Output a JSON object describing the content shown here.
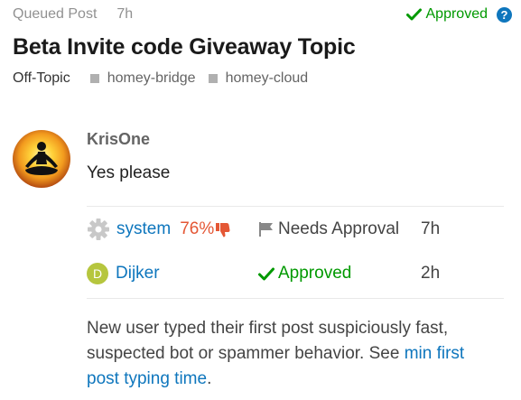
{
  "header": {
    "queued_label": "Queued Post",
    "queued_time": "7h",
    "status": "Approved"
  },
  "topic": {
    "title": "Beta Invite code Giveaway Topic",
    "category": "Off-Topic",
    "tags": [
      "homey-bridge",
      "homey-cloud"
    ]
  },
  "post": {
    "author": "KrisOne",
    "body": "Yes please"
  },
  "reviews": [
    {
      "user": "system",
      "score": "76%",
      "action": "Needs Approval",
      "time": "7h"
    },
    {
      "user": "Dijker",
      "avatar_letter": "D",
      "action": "Approved",
      "time": "2h"
    }
  ],
  "explanation": {
    "text": "New user typed their first post suspiciously fast, suspected bot or spammer behavior. See ",
    "link": "min first post typing time",
    "suffix": "."
  },
  "colors": {
    "approved": "#009900",
    "link": "#0e76bd",
    "score": "#e45735",
    "tag_square": "#b0b0b0",
    "avatar_letter_bg": "#b6c63e"
  },
  "icons": [
    "check-icon",
    "help-icon",
    "gear-icon",
    "thumbs-down-icon",
    "flag-icon",
    "meditation-avatar"
  ]
}
